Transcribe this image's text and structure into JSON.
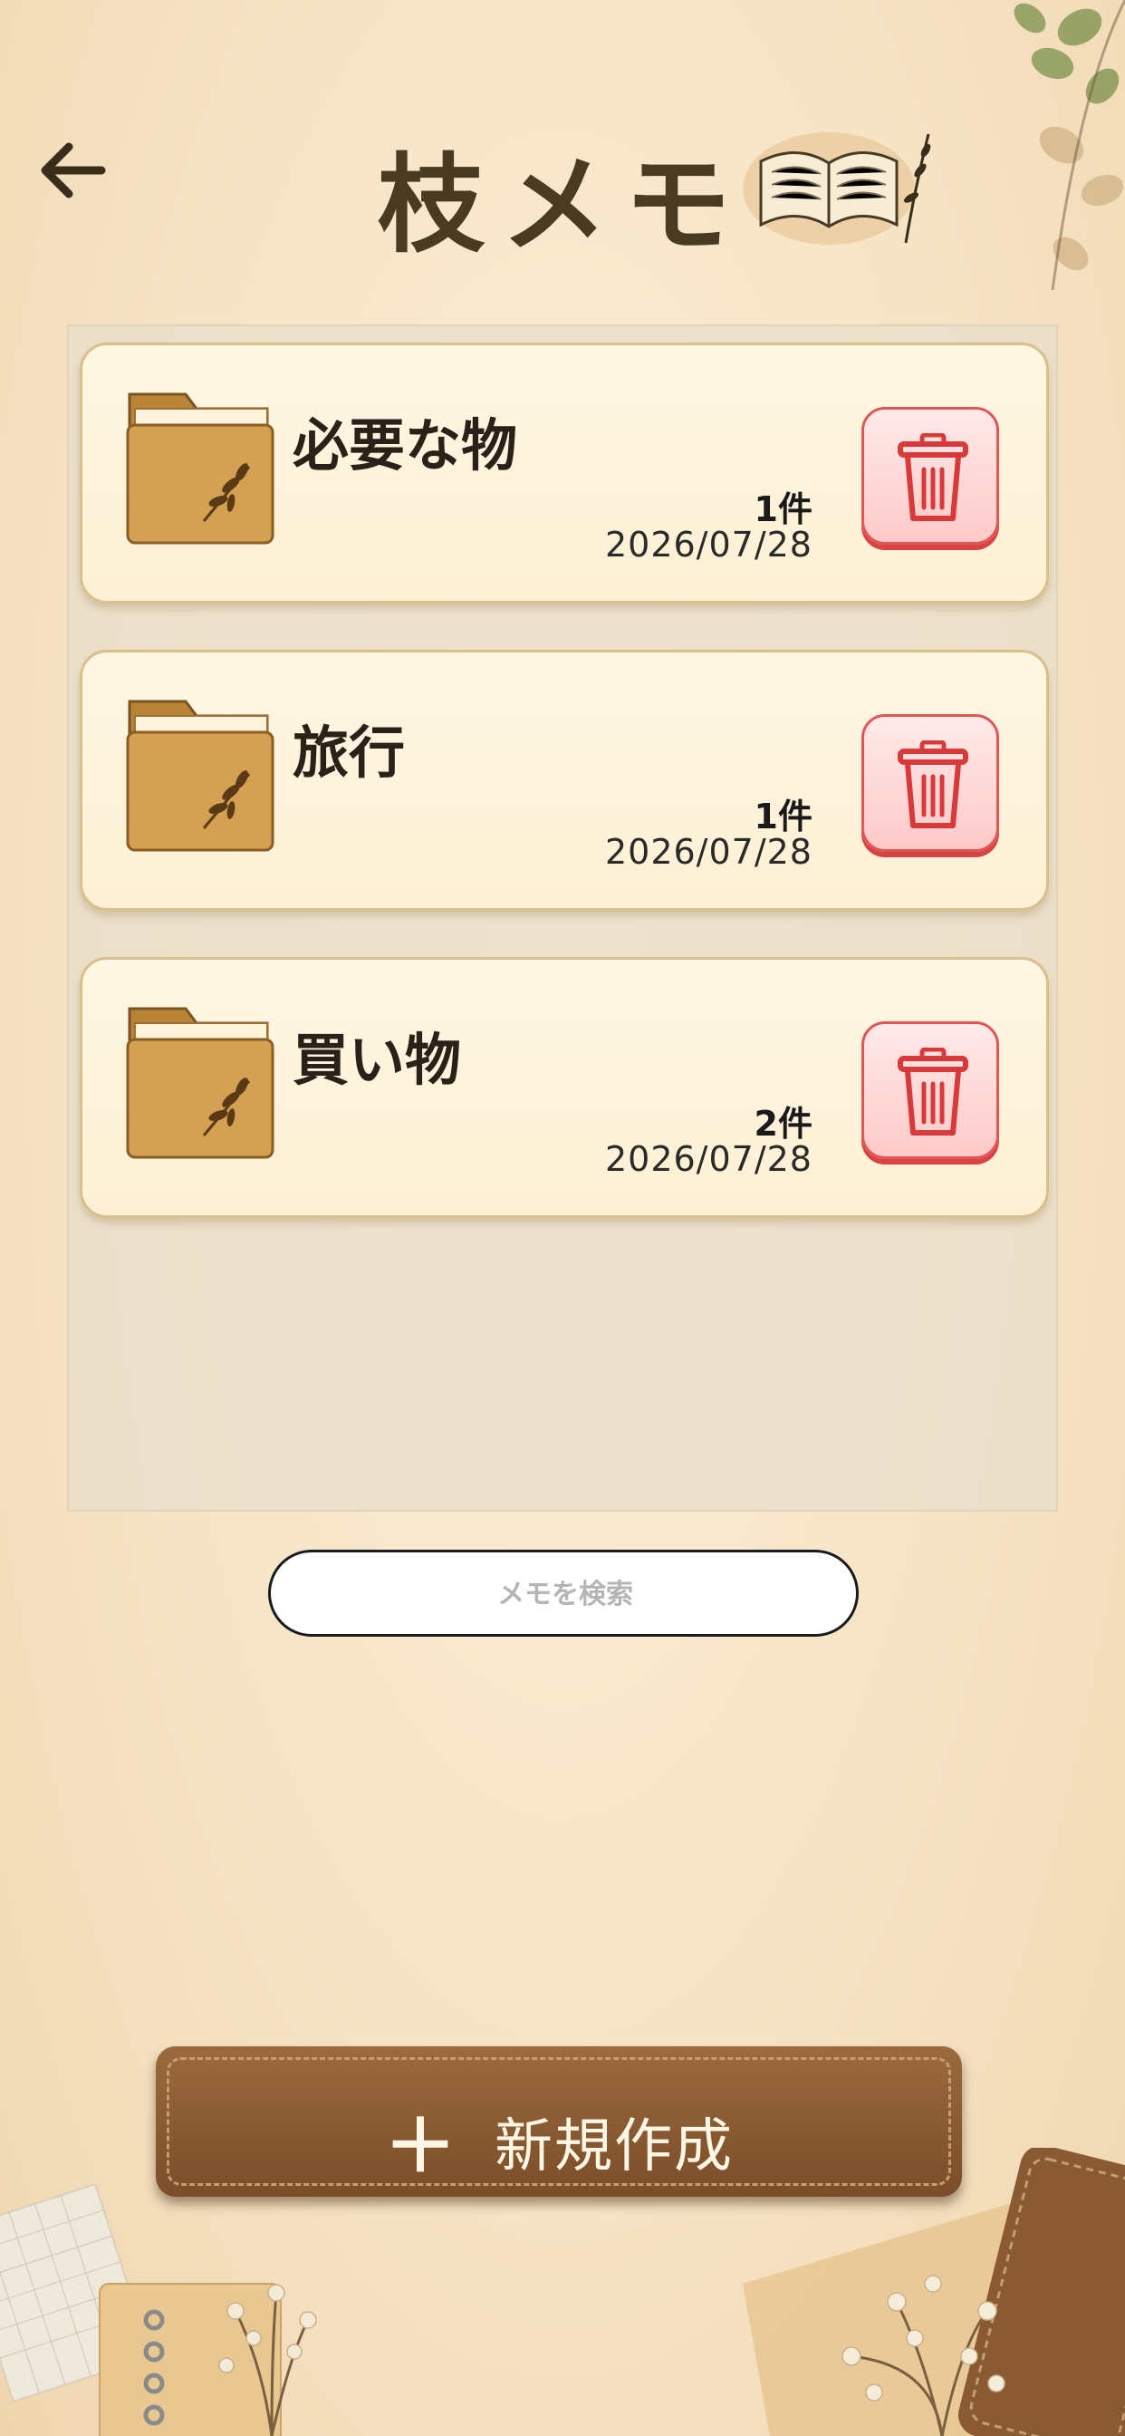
{
  "header": {
    "title": "枝メモ",
    "back_icon": "arrow-left-icon"
  },
  "folders": [
    {
      "name": "必要な物",
      "count": "1件",
      "date": "2026/07/28"
    },
    {
      "name": "旅行",
      "count": "1件",
      "date": "2026/07/28"
    },
    {
      "name": "買い物",
      "count": "2件",
      "date": "2026/07/28"
    }
  ],
  "search": {
    "placeholder": "メモを検索"
  },
  "new_button": {
    "plus": "＋",
    "label": "新規作成"
  },
  "colors": {
    "accent_brown": "#8a5a32",
    "title_text": "#4a3a22",
    "delete_red": "#e25555",
    "card_bg": "#fff7e4"
  }
}
